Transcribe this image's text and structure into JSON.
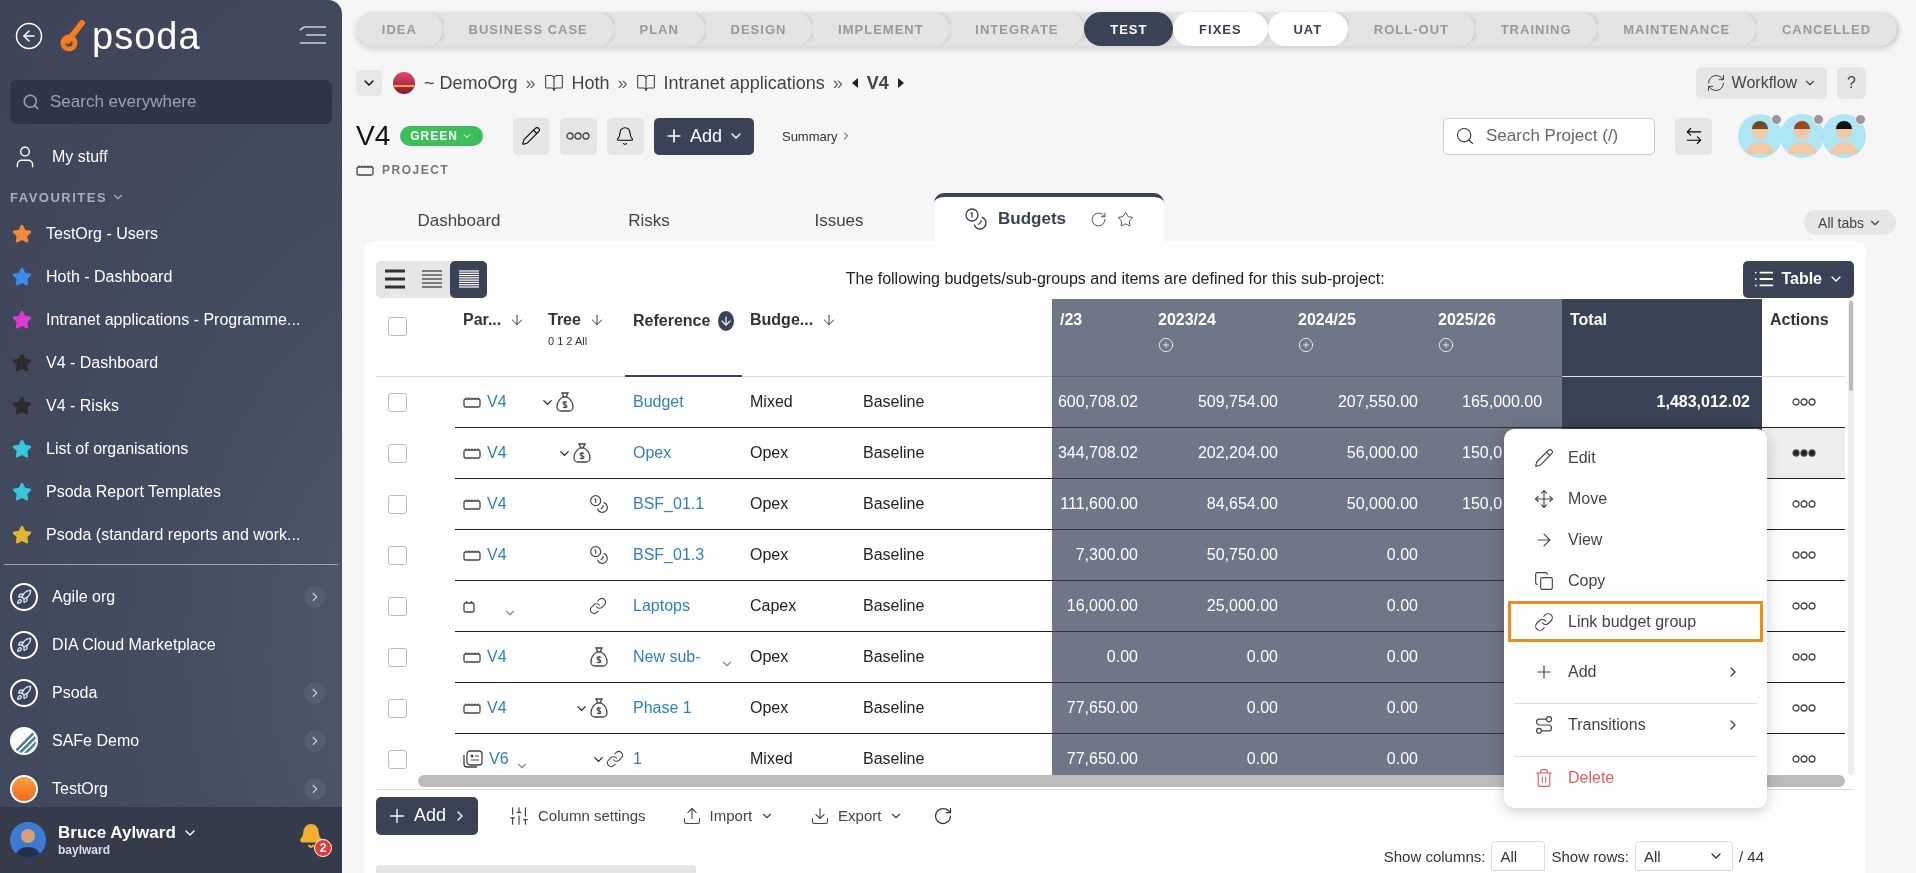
{
  "sidebar": {
    "logo": "psoda",
    "search_placeholder": "Search everywhere",
    "my_stuff": "My stuff",
    "favourites_heading": "FAVOURITES",
    "favourites": [
      {
        "label": "TestOrg - Users",
        "color": "#f58a3c"
      },
      {
        "label": "Hoth - Dashboard",
        "color": "#3b8beb"
      },
      {
        "label": "Intranet applications - Programme...",
        "color": "#e03ad6"
      },
      {
        "label": "V4 - Dashboard",
        "color": "#2b2b2b"
      },
      {
        "label": "V4 - Risks",
        "color": "#2b2b2b"
      },
      {
        "label": "List of organisations",
        "color": "#37c6dc"
      },
      {
        "label": "Psoda Report Templates",
        "color": "#37c6dc"
      },
      {
        "label": "Psoda (standard reports and work...",
        "color": "#e3b52c"
      }
    ],
    "organisations": [
      {
        "label": "Agile org",
        "kind": "rocket",
        "expandable": true
      },
      {
        "label": "DIA Cloud Marketplace",
        "kind": "rocket",
        "expandable": false
      },
      {
        "label": "Psoda",
        "kind": "rocket",
        "expandable": true
      },
      {
        "label": "SAFe Demo",
        "kind": "stripes",
        "expandable": true
      },
      {
        "label": "TestOrg",
        "kind": "sun",
        "expandable": true
      }
    ],
    "user": {
      "name": "Bruce Aylward",
      "login": "baylward",
      "notifications": "2"
    }
  },
  "stages": [
    {
      "label": "IDEA",
      "selected": false,
      "available": false
    },
    {
      "label": "BUSINESS CASE",
      "selected": false,
      "available": false
    },
    {
      "label": "PLAN",
      "selected": false,
      "available": false
    },
    {
      "label": "DESIGN",
      "selected": false,
      "available": false
    },
    {
      "label": "IMPLEMENT",
      "selected": false,
      "available": false
    },
    {
      "label": "INTEGRATE",
      "selected": false,
      "available": false
    },
    {
      "label": "TEST",
      "selected": true,
      "available": false
    },
    {
      "label": "FIXES",
      "selected": false,
      "available": true
    },
    {
      "label": "UAT",
      "selected": false,
      "available": true
    },
    {
      "label": "ROLL-OUT",
      "selected": false,
      "available": false
    },
    {
      "label": "TRAINING",
      "selected": false,
      "available": false
    },
    {
      "label": "MAINTENANCE",
      "selected": false,
      "available": false
    },
    {
      "label": "CANCELLED",
      "selected": false,
      "available": false
    }
  ],
  "breadcrumb": {
    "items": [
      "~ DemoOrg",
      "Hoth",
      "Intranet applications"
    ],
    "separator": "»",
    "current": "V4"
  },
  "workflow_button": "Workflow",
  "help_button": "?",
  "header": {
    "title": "V4",
    "status": "GREEN",
    "add_button": "Add",
    "summary_link": "Summary",
    "type_label": "PROJECT",
    "search_placeholder": "Search Project (/)"
  },
  "tabs": [
    {
      "label": "Dashboard",
      "selected": false
    },
    {
      "label": "Risks",
      "selected": false
    },
    {
      "label": "Issues",
      "selected": false
    },
    {
      "label": "Budgets",
      "selected": true
    }
  ],
  "all_tabs_button": "All tabs",
  "view_toggles": [
    {
      "selected": false
    },
    {
      "selected": false
    },
    {
      "selected": true
    }
  ],
  "description": "The following budgets/sub-groups and items are defined for this sub-project:",
  "view_button": "Table",
  "table": {
    "select_all": {
      "checked": false
    },
    "columns": [
      {
        "label": "Par...",
        "sorted": false
      },
      {
        "label": "Tree",
        "sub": "0 1 2 All",
        "sorted": false
      },
      {
        "label": "Reference",
        "sorted": true
      },
      {
        "label": "Budge...",
        "sorted": false
      }
    ],
    "year_columns": [
      "/23",
      "2023/24",
      "2024/25",
      "2025/26"
    ],
    "total_label": "Total",
    "actions_label": "Actions",
    "rows": [
      {
        "checked": false,
        "par": {
          "text": "V4",
          "kind": "tray"
        },
        "expanded": true,
        "kind": "bag",
        "reference": "Budget",
        "type": "Mixed",
        "version": "Baseline",
        "years": [
          "600,708.02",
          "509,754.00",
          "207,550.00",
          "165,000.00"
        ],
        "total": "1,483,012.02",
        "menu_open": false,
        "children": [
          {
            "checked": false,
            "par": {
              "text": "V4",
              "kind": "tray"
            },
            "expanded": true,
            "kind": "bag",
            "reference": "Opex",
            "type": "Opex",
            "version": "Baseline",
            "years": [
              "344,708.02",
              "202,204.00",
              "56,000.00",
              "150,0"
            ],
            "menu_open": true,
            "children": [
              {
                "checked": false,
                "par": {
                  "text": "V4",
                  "kind": "tray"
                },
                "kind": "coins",
                "reference": "BSF_01.1",
                "type": "Opex",
                "version": "Baseline",
                "years": [
                  "111,600.00",
                  "84,654.00",
                  "50,000.00",
                  "150,0"
                ],
                "menu_open": false
              },
              {
                "checked": false,
                "par": {
                  "text": "V4",
                  "kind": "tray"
                },
                "kind": "coins",
                "reference": "BSF_01.3",
                "type": "Opex",
                "version": "Baseline",
                "years": [
                  "7,300.00",
                  "50,750.00",
                  "0.00"
                ],
                "menu_open": false
              },
              {
                "checked": false,
                "par": {
                  "kind": "small",
                  "menu": true
                },
                "kind": "link",
                "reference": "Laptops",
                "type": "Capex",
                "version": "Baseline",
                "years": [
                  "16,000.00",
                  "25,000.00",
                  "0.00"
                ],
                "menu_open": false
              },
              {
                "checked": false,
                "par": {
                  "text": "V4",
                  "kind": "tray"
                },
                "kind": "bag",
                "reference": "New sub-",
                "ref_menu": true,
                "type": "Opex",
                "version": "Baseline",
                "years": [
                  "0.00",
                  "0.00",
                  "0.00"
                ],
                "menu_open": false
              },
              {
                "checked": false,
                "par": {
                  "text": "V4",
                  "kind": "tray"
                },
                "expanded": true,
                "kind": "bag",
                "reference": "Phase 1",
                "type": "Opex",
                "version": "Baseline",
                "years": [
                  "77,650.00",
                  "0.00",
                  "0.00"
                ],
                "menu_open": false,
                "children": [
                  {
                    "checked": false,
                    "par": {
                      "text": "V6",
                      "kind": "document",
                      "menu": true
                    },
                    "expanded": true,
                    "kind": "link",
                    "reference": "1",
                    "type": "Mixed",
                    "version": "Baseline",
                    "years": [
                      "77,650.00",
                      "0.00",
                      "0.00"
                    ],
                    "menu_open": false
                  }
                ]
              }
            ]
          }
        ]
      }
    ]
  },
  "footer": {
    "add_button": "Add",
    "column_settings": "Column settings",
    "import": "Import",
    "export": "Export",
    "show_columns_label": "Show columns:",
    "show_columns_value": "All",
    "show_rows_label": "Show rows:",
    "show_rows_value": "All",
    "total_rows": "/ 44"
  },
  "context_menu": [
    {
      "label": "Edit",
      "kind": "edit",
      "highlighted": false
    },
    {
      "label": "Move",
      "kind": "move",
      "highlighted": false
    },
    {
      "label": "View",
      "kind": "view",
      "highlighted": false
    },
    {
      "label": "Copy",
      "kind": "copy",
      "highlighted": false
    },
    {
      "label": "Link budget group",
      "kind": "link",
      "highlighted": true
    },
    {
      "label": "Add",
      "kind": "add",
      "highlighted": false,
      "submenu": true
    },
    {
      "label": "Transitions",
      "kind": "transitions",
      "highlighted": false,
      "submenu": true,
      "divider_before": true
    },
    {
      "label": "Delete",
      "kind": "delete",
      "highlighted": false,
      "danger": true,
      "divider_before": true
    }
  ]
}
